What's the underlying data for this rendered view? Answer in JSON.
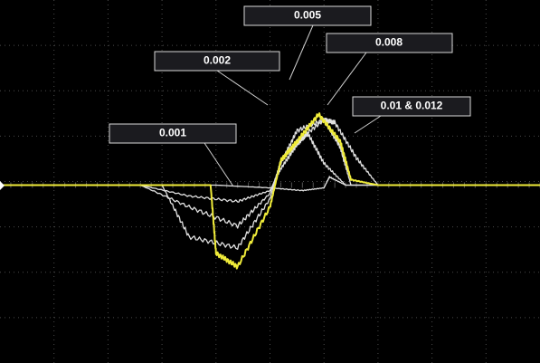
{
  "chart_data": {
    "type": "line",
    "title": "",
    "xlabel": "",
    "ylabel": "",
    "grid": true,
    "grid_divisions": {
      "x": 10,
      "y": 8
    },
    "annotations": [
      "0.001",
      "0.002",
      "0.005",
      "0.008",
      "0.01 & 0.012"
    ],
    "series": [
      {
        "color": "#e0e0e0",
        "x": [
          0,
          4.0,
          5.0,
          5.6,
          6.0,
          6.1,
          6.4,
          7.0,
          10
        ],
        "y": [
          0,
          0,
          -0.1,
          -0.2,
          -0.1,
          0.3,
          0.0,
          0,
          0
        ]
      },
      {
        "color": "#e0e0e0",
        "x": [
          0,
          2.6,
          3.5,
          4.4,
          5.0,
          5.2,
          5.5,
          5.7,
          6.0,
          6.4,
          7.0,
          10
        ],
        "y": [
          0,
          0,
          -0.4,
          -0.6,
          -0.2,
          0.6,
          1.5,
          1.9,
          0.8,
          0.0,
          0,
          0
        ]
      },
      {
        "color": "#e0e0e0",
        "x": [
          0,
          2.6,
          3.5,
          4.4,
          5.0,
          5.2,
          5.5,
          6.0,
          6.3,
          6.5,
          7.0,
          10
        ],
        "y": [
          0,
          0,
          -0.8,
          -1.5,
          -0.3,
          0.8,
          2.0,
          2.4,
          1.4,
          0.0,
          0,
          0
        ]
      },
      {
        "color": "#e0e0e0",
        "x": [
          0,
          3.0,
          3.5,
          4.4,
          5.0,
          5.2,
          5.5,
          6.0,
          6.2,
          6.6,
          7.0,
          10
        ],
        "y": [
          0,
          0,
          -1.9,
          -2.3,
          -0.5,
          0.9,
          1.6,
          2.4,
          2.3,
          1.0,
          0,
          0
        ]
      },
      {
        "color": "#f0ec3a",
        "x": [
          0,
          3.9,
          4.0,
          4.4,
          5.0,
          5.2,
          5.5,
          5.9,
          6.3,
          6.5,
          7.0,
          10
        ],
        "y": [
          0,
          0,
          -2.5,
          -3.0,
          -0.8,
          0.9,
          1.6,
          2.6,
          1.6,
          0.2,
          0,
          0
        ]
      }
    ]
  }
}
